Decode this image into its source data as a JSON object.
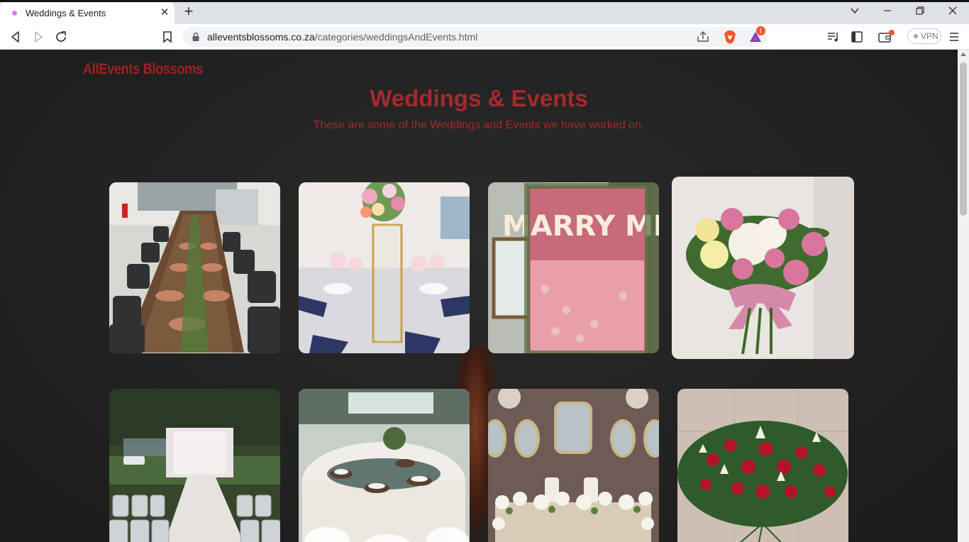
{
  "browser": {
    "tab_title": "Weddings & Events",
    "tab_close": "✕",
    "new_tab": "+",
    "url_host": "alleventsblossoms.co.za",
    "url_path": "/categories/weddingsAndEvents.html",
    "vpn_label": "VPN",
    "brave_badge_count": "1",
    "win_controls": [
      "⌄",
      "—",
      "❐",
      "✕"
    ],
    "icons": {
      "back": "back-arrow-icon",
      "forward": "forward-arrow-icon",
      "reload": "reload-icon",
      "bookmark": "bookmark-icon",
      "lock": "lock-icon",
      "share": "share-icon",
      "brave": "brave-shield-icon",
      "rewards": "brave-rewards-icon",
      "playlist": "playlist-icon",
      "sidebar": "sidebar-icon",
      "wallet": "wallet-icon",
      "menu": "menu-icon"
    }
  },
  "site": {
    "brand": "AllEvents Blossoms",
    "title": "Weddings & Events",
    "subtitle": "These are some of the Weddings and Events we have worked on.",
    "colors": {
      "accent": "#a52a2a",
      "background": "#222222"
    },
    "gallery": [
      {
        "alt": "Long dinner table with chargers and greenery runner"
      },
      {
        "alt": "Tall gold centerpiece with roses on mirror table"
      },
      {
        "alt": "MARRY ME rose flower wall",
        "text": "MARRY ME"
      },
      {
        "alt": "Pink and white rose bridal bouquet with ribbon"
      },
      {
        "alt": "Outdoor ceremony aisle with white chairs"
      },
      {
        "alt": "Round reception table with white linens"
      },
      {
        "alt": "Head table with mirrors and white flowers"
      },
      {
        "alt": "Red rose and lily casket spray"
      }
    ]
  }
}
